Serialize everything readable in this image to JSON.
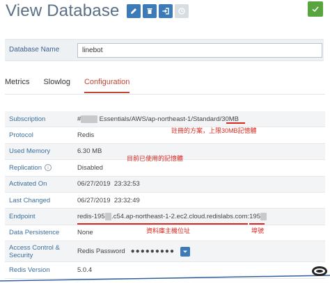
{
  "header": {
    "title": "View Database",
    "buttons": [
      {
        "name": "edit",
        "icon": "pencil-icon"
      },
      {
        "name": "delete",
        "icon": "trash-icon"
      },
      {
        "name": "import",
        "icon": "import-icon"
      },
      {
        "name": "backup",
        "icon": "history-icon",
        "disabled": true
      }
    ],
    "confirm_icon": "check-icon"
  },
  "database_name": {
    "label": "Database Name",
    "value": "linebot"
  },
  "tabs": [
    {
      "label": "Metrics",
      "active": false
    },
    {
      "label": "Slowlog",
      "active": false
    },
    {
      "label": "Configuration",
      "active": true
    }
  ],
  "config": {
    "subscription": {
      "label": "Subscription",
      "prefix": "#",
      "masked": "xxxxx",
      "value": " Essentials/AWS/ap-northeast-1/Standard/30MB"
    },
    "protocol": {
      "label": "Protocol",
      "value": "Redis"
    },
    "used_memory": {
      "label": "Used Memory",
      "value": "6.30 MB"
    },
    "replication": {
      "label": "Replication",
      "value": "Disabled"
    },
    "activated_on": {
      "label": "Activated On",
      "value": "06/27/2019  23:32:53"
    },
    "last_changed": {
      "label": "Last Changed",
      "value": "06/27/2019  23:32:49"
    },
    "endpoint": {
      "label": "Endpoint",
      "part1": "redis-195",
      "masked1": "xx",
      "part2": ".c54.ap-northeast-1-2.ec2.cloud.redislabs.com:195",
      "masked2": "xx"
    },
    "data_persistence": {
      "label": "Data Persistence",
      "value": "None"
    },
    "access_control": {
      "label": "Access Control & Security",
      "method": "Redis Password",
      "password": "●●●●●●●●●"
    },
    "redis_version": {
      "label": "Redis Version",
      "value": "5.0.4"
    }
  },
  "annotations": {
    "plan": "註冊的方案，上限30MB記憶體",
    "used": "目前已使用的記憶體",
    "host": "資料庫主機位址",
    "port": "埠號"
  },
  "colors": {
    "title": "#5b6f84",
    "primary_button": "#3d7ab8",
    "confirm_button": "#58a53d",
    "active_tab": "#c44535",
    "label": "#3b6e9e",
    "annotation": "#d8281f"
  }
}
